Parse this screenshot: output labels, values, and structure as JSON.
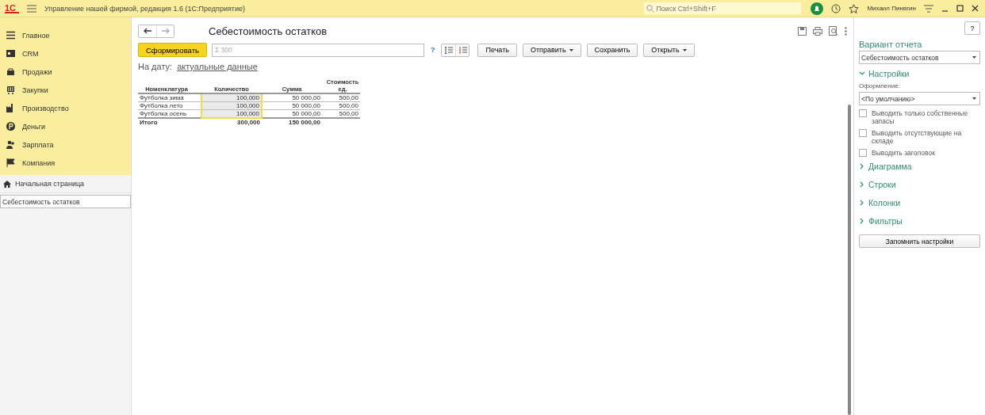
{
  "window": {
    "logo": "1С",
    "title": "Управление нашей фирмой, редакция 1.6  (1С:Предприятие)",
    "search": {
      "placeholder": "Поиск Ctrl+Shift+F"
    },
    "user": "Михаил Пинягин"
  },
  "sidebar": {
    "sections": [
      {
        "label": "Главное"
      },
      {
        "label": "CRM"
      },
      {
        "label": "Продажи"
      },
      {
        "label": "Закупки"
      },
      {
        "label": "Производство"
      },
      {
        "label": "Деньги"
      },
      {
        "label": "Зарплата"
      },
      {
        "label": "Компания"
      }
    ],
    "open_pages": [
      {
        "label": "Начальная страница",
        "home": true,
        "selected": false
      },
      {
        "label": "Себестоимость остатков",
        "home": false,
        "selected": true
      }
    ]
  },
  "report": {
    "title": "Себестоимость остатков",
    "generate_button": "Сформировать",
    "sum_field": {
      "value": "Σ 300"
    },
    "help_mark": "?",
    "buttons": [
      {
        "label": "Печать",
        "dropdown": false
      },
      {
        "label": "Отправить",
        "dropdown": true
      },
      {
        "label": "Сохранить",
        "dropdown": false
      },
      {
        "label": "Открыть",
        "dropdown": true
      }
    ],
    "help_button": "?",
    "date_label": "На дату:",
    "date_link": "актуальные данные",
    "table": {
      "columns": [
        "Номенклатура",
        "Количество",
        "Сумма",
        "Стоимость ед."
      ],
      "rows": [
        {
          "cells": [
            "Футболка зима",
            "100,000",
            "50 000,00",
            "500,00"
          ],
          "selected": true
        },
        {
          "cells": [
            "Футболка лето",
            "100,000",
            "50 000,00",
            "500,00"
          ],
          "selected": true
        },
        {
          "cells": [
            "Футболка осень",
            "100,000",
            "50 000,00",
            "500,00"
          ],
          "selected": true
        }
      ],
      "total": [
        "Итого",
        "300,000",
        "150 000,00"
      ]
    }
  },
  "settings_panel": {
    "variant_label": "Вариант отчета",
    "variant_value": "Себестоимость остатков",
    "settings_group": {
      "label": "Настройки",
      "expanded": true
    },
    "design_label": "Оформление:",
    "design_value": "<По умолчанию>",
    "checkboxes": [
      {
        "label": "Выводить только собственные запасы",
        "checked": false
      },
      {
        "label": "Выводить отсутствующие на складе",
        "checked": false
      },
      {
        "label": "Выводить заголовок",
        "checked": false
      }
    ],
    "groups": [
      {
        "label": "Диаграмма",
        "expanded": false
      },
      {
        "label": "Строки",
        "expanded": false
      },
      {
        "label": "Колонки",
        "expanded": false
      },
      {
        "label": "Фильтры",
        "expanded": false
      }
    ],
    "save_button": "Запомнить настройки"
  }
}
